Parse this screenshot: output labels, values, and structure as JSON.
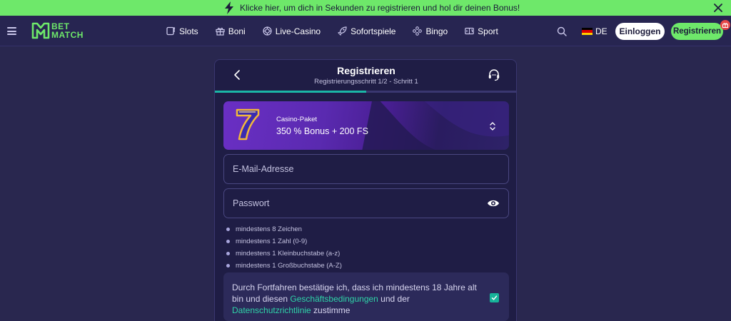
{
  "promo": {
    "text": "Klicke hier, um dich in Sekunden zu registrieren und hol dir deinen Bonus!"
  },
  "header": {
    "logo_line1": "BET",
    "logo_line2": "MATCH",
    "nav": [
      {
        "label": "Slots",
        "icon": "slot-icon"
      },
      {
        "label": "Boni",
        "icon": "gift-icon"
      },
      {
        "label": "Live-Casino",
        "icon": "chip-icon"
      },
      {
        "label": "Sofortspiele",
        "icon": "rocket-icon"
      },
      {
        "label": "Bingo",
        "icon": "bingo-icon"
      },
      {
        "label": "Sport",
        "icon": "scoreboard-icon"
      }
    ],
    "language": "DE",
    "login_label": "Einloggen",
    "register_label": "Registrieren"
  },
  "modal": {
    "title": "Registrieren",
    "subtitle": "Registrierungsschritt 1/2 - Schritt 1",
    "progress": 0.5,
    "bonus": {
      "label": "Casino-Paket",
      "value": "350 % Bonus + 200 FS"
    },
    "email_placeholder": "E-Mail-Adresse",
    "password_placeholder": "Passwort",
    "password_rules": [
      "mindestens 8 Zeichen",
      "mindestens 1 Zahl (0-9)",
      "mindestens 1 Kleinbuchstabe (a-z)",
      "mindestens 1 Großbuchstabe (A-Z)"
    ],
    "consent": {
      "part1": "Durch Fortfahren bestätige ich, dass ich mindestens 18 Jahre alt bin und diesen ",
      "link1": "Geschäftsbedingungen",
      "part2": " und der ",
      "link2": "Datenschutzrichtlinie",
      "part3": " zustimme",
      "checked": true
    }
  },
  "colors": {
    "accent": "#6ee86a",
    "background": "#29274f",
    "link": "#2fd3a8"
  }
}
